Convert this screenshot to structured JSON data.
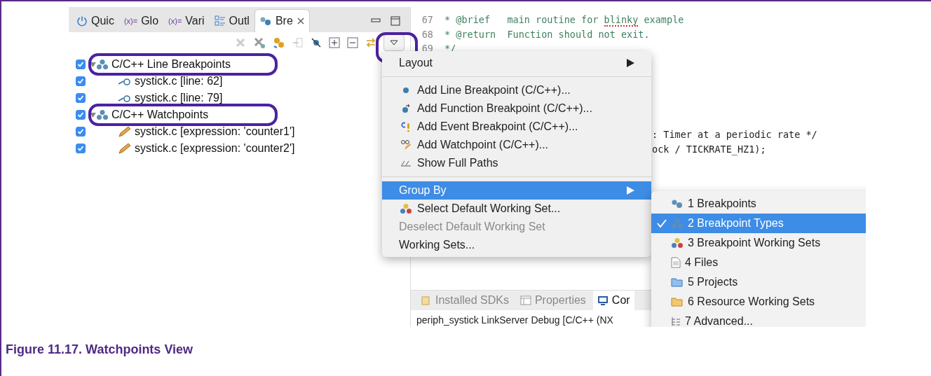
{
  "view_tabs": [
    {
      "label": "Quic",
      "selected": false
    },
    {
      "label": "Glo",
      "icon_text": "(x)=",
      "selected": false
    },
    {
      "label": "Vari",
      "icon_text": "(x)=",
      "selected": false
    },
    {
      "label": "Outl",
      "selected": false
    },
    {
      "label": "Bre",
      "selected": true
    }
  ],
  "view_menu_circled": true,
  "breakpoints": [
    {
      "label": "C/C++ Line Breakpoints",
      "checked": true,
      "expanded": true,
      "circled": true,
      "children": [
        {
          "label": "systick.c [line: 62]",
          "kind": "line",
          "checked": true
        },
        {
          "label": "systick.c [line: 79]",
          "kind": "line",
          "checked": true
        }
      ]
    },
    {
      "label": "C/C++ Watchpoints",
      "checked": true,
      "expanded": true,
      "circled": true,
      "children": [
        {
          "label": "systick.c [expression: 'counter1']",
          "kind": "watch",
          "checked": true
        },
        {
          "label": "systick.c [expression: 'counter2']",
          "kind": "watch",
          "checked": true
        }
      ]
    }
  ],
  "code_lines": [
    {
      "kind": "full",
      "number": "67",
      "segments": [
        {
          "text": "* @brief   main routine for ",
          "misspelled": false
        },
        {
          "text": "blinky",
          "misspelled": true
        },
        {
          "text": " example",
          "misspelled": false
        }
      ]
    },
    {
      "kind": "full",
      "number": "68",
      "segments": [
        {
          "text": "* @return  Function should not exit."
        }
      ]
    },
    {
      "kind": "full",
      "number": "69",
      "segments": [
        {
          "text": "*/"
        }
      ]
    },
    {
      "kind": "blank"
    },
    {
      "kind": "blank"
    },
    {
      "kind": "blank"
    },
    {
      "kind": "blank"
    },
    {
      "kind": "blank"
    },
    {
      "kind": "fragment",
      "segments": [
        {
          "text": ": Timer at a periodic rate */"
        }
      ]
    },
    {
      "kind": "fragment",
      "segments": [
        {
          "text": "ock / TICKRATE_HZ1);"
        }
      ]
    }
  ],
  "bottom_tabs": [
    {
      "label": "Installed SDKs",
      "selected": false
    },
    {
      "label": "Properties",
      "selected": false
    },
    {
      "label": "Cor",
      "selected": true
    }
  ],
  "console_line": "periph_systick LinkServer Debug [C/C++ (NX",
  "menu": [
    {
      "kind": "submenu",
      "label": "Layout",
      "selected": false,
      "disabled": false
    },
    {
      "kind": "separator"
    },
    {
      "kind": "item",
      "label": "Add Line Breakpoint (C/C++)...",
      "selected": false,
      "disabled": false
    },
    {
      "kind": "item",
      "label": "Add Function Breakpoint (C/C++)...",
      "selected": false,
      "disabled": false
    },
    {
      "kind": "item",
      "label": "Add Event Breakpoint (C/C++)...",
      "selected": false,
      "disabled": false
    },
    {
      "kind": "item",
      "label": "Add Watchpoint (C/C++)...",
      "selected": false,
      "disabled": false
    },
    {
      "kind": "item",
      "label": "Show Full Paths",
      "selected": false,
      "disabled": false
    },
    {
      "kind": "separator"
    },
    {
      "kind": "submenu",
      "label": "Group By",
      "selected": true,
      "disabled": false
    },
    {
      "kind": "item",
      "label": "Select Default Working Set...",
      "selected": false,
      "disabled": false
    },
    {
      "kind": "item",
      "label": "Deselect Default Working Set",
      "selected": false,
      "disabled": true
    },
    {
      "kind": "item",
      "label": "Working Sets...",
      "selected": false,
      "disabled": false
    }
  ],
  "group_by_menu": [
    {
      "label": "1 Breakpoints",
      "checked": false,
      "selected": false
    },
    {
      "label": "2 Breakpoint Types",
      "checked": true,
      "selected": true
    },
    {
      "label": "3 Breakpoint Working Sets",
      "checked": false,
      "selected": false
    },
    {
      "label": "4 Files",
      "checked": false,
      "selected": false
    },
    {
      "label": "5 Projects",
      "checked": false,
      "selected": false
    },
    {
      "label": "6 Resource Working Sets",
      "checked": false,
      "selected": false
    },
    {
      "label": "7 Advanced...",
      "checked": false,
      "selected": false
    }
  ],
  "caption": "Figure 11.17. Watchpoints View"
}
